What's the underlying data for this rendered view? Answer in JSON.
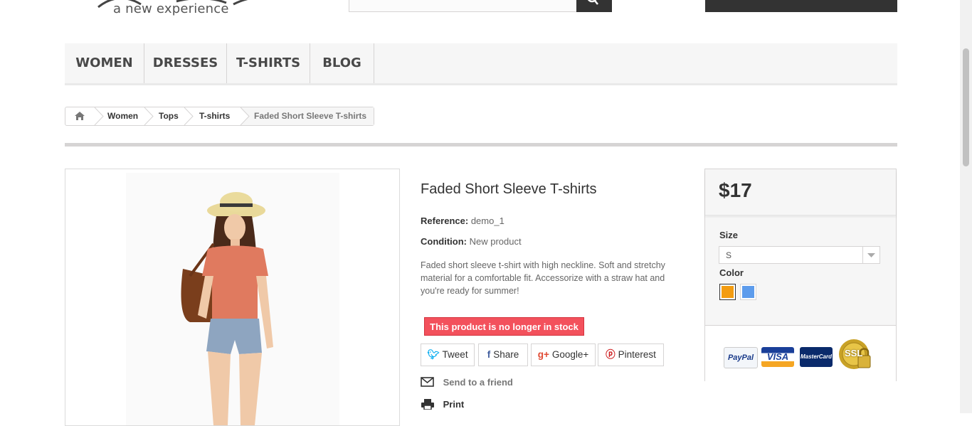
{
  "header": {
    "logo_tagline": "a new experience"
  },
  "nav": {
    "items": [
      {
        "label": "WOMEN"
      },
      {
        "label": "DRESSES"
      },
      {
        "label": "T-SHIRTS"
      },
      {
        "label": "BLOG"
      }
    ]
  },
  "breadcrumb": {
    "home_icon": "home-icon",
    "items": [
      {
        "label": "Women"
      },
      {
        "label": "Tops"
      },
      {
        "label": "T-shirts"
      },
      {
        "label": "Faded Short Sleeve T-shirts"
      }
    ]
  },
  "product": {
    "title": "Faded Short Sleeve T-shirts",
    "reference_label": "Reference:",
    "reference_value": "demo_1",
    "condition_label": "Condition:",
    "condition_value": "New product",
    "description": "Faded short sleeve t-shirt with high neckline. Soft and stretchy material for a comfortable fit. Accessorize with a straw hat and you're ready for summer!",
    "stock_notice": "This product is no longer in stock",
    "share_buttons": [
      {
        "label": "Tweet",
        "icon": "twitter-icon"
      },
      {
        "label": "Share",
        "icon": "facebook-icon"
      },
      {
        "label": "Google+",
        "icon": "google-plus-icon"
      },
      {
        "label": "Pinterest",
        "icon": "pinterest-icon"
      }
    ],
    "send_to_friend": "Send to a friend",
    "print": "Print"
  },
  "buy_box": {
    "price": "$17",
    "size_label": "Size",
    "size_value": "S",
    "color_label": "Color",
    "colors": [
      "#f39c11",
      "#5d9cec"
    ],
    "payment_cards": [
      "PayPal",
      "VISA",
      "MasterCard",
      "SSL"
    ]
  },
  "colors": {
    "stock_notice_bg": "#f3515c",
    "dark_bar": "#333333",
    "nav_bg": "#f6f6f6"
  }
}
